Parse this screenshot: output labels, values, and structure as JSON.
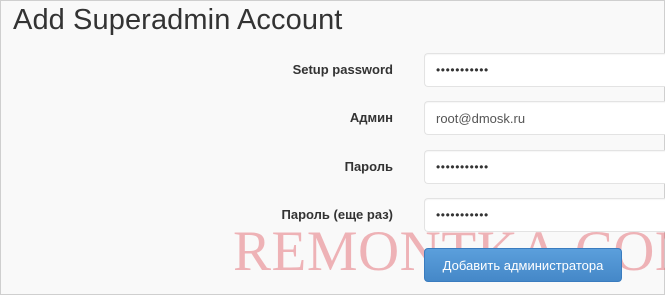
{
  "page": {
    "title": "Add Superadmin Account"
  },
  "form": {
    "fields": [
      {
        "label": "Setup password",
        "value": "•••••••••••",
        "type": "password"
      },
      {
        "label": "Админ",
        "value": "root@dmosk.ru",
        "type": "text"
      },
      {
        "label": "Пароль",
        "value": "•••••••••••",
        "type": "password"
      },
      {
        "label": "Пароль (еще раз)",
        "value": "•••••••••••",
        "type": "password"
      }
    ],
    "submit_label": "Добавить администратора"
  },
  "watermark": {
    "text": "REMONTKA.COM"
  },
  "colors": {
    "button": "#4a8fd0",
    "background": "#f8f8f8",
    "watermark": "#e1505a"
  }
}
